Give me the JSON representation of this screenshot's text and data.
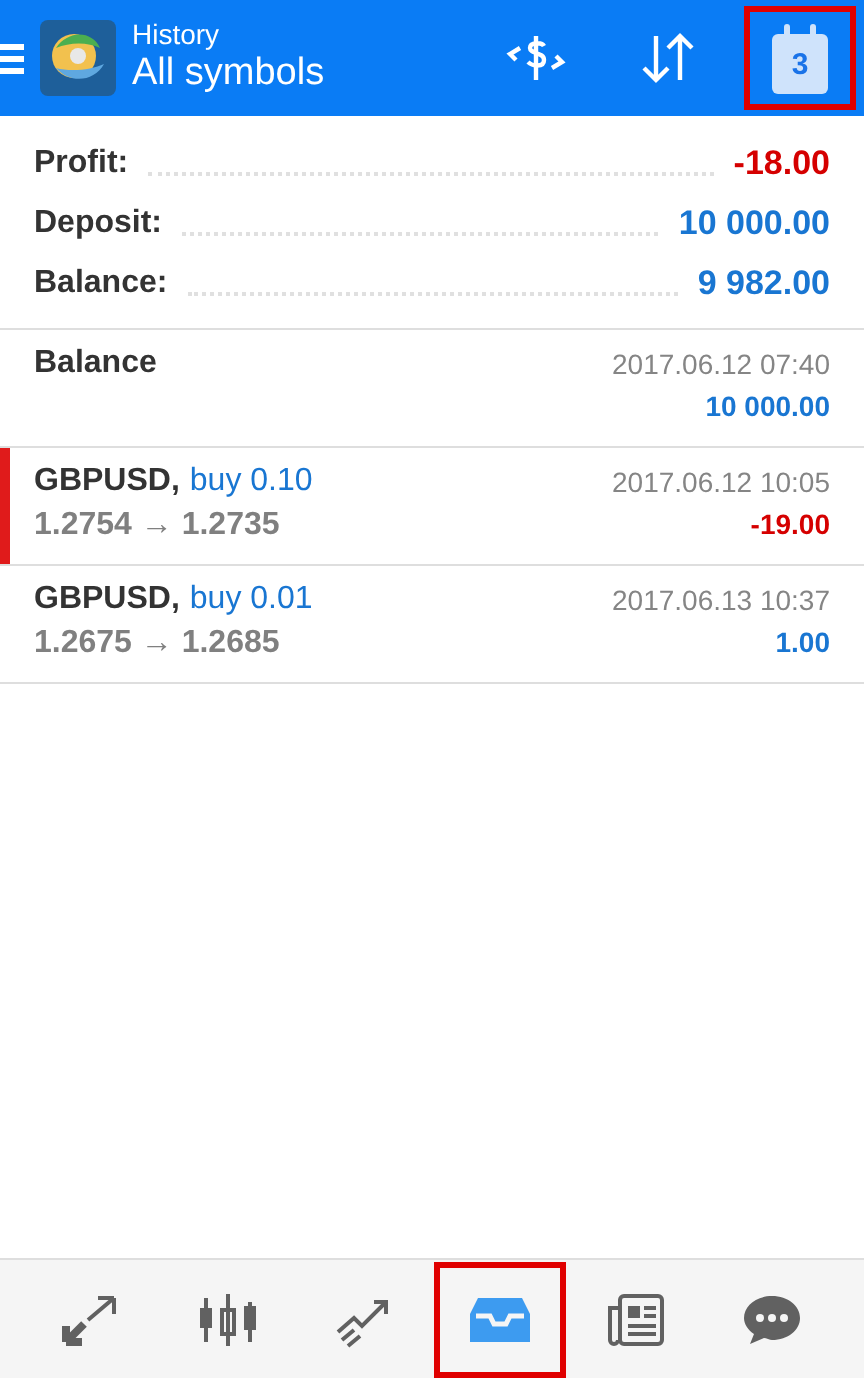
{
  "header": {
    "title": "History",
    "subtitle": "All symbols",
    "actions": [
      {
        "kind": "currency",
        "highlighted": false
      },
      {
        "kind": "sort",
        "highlighted": false
      },
      {
        "kind": "calendar",
        "label": "3",
        "highlighted": true
      }
    ]
  },
  "summary": [
    {
      "label": "Profit:",
      "value": "-18.00",
      "color": "#d50000"
    },
    {
      "label": "Deposit:",
      "value": "10 000.00",
      "color": "#1976d2"
    },
    {
      "label": "Balance:",
      "value": "9 982.00",
      "color": "#1976d2"
    }
  ],
  "entries": [
    {
      "kind": "balance",
      "title": "Balance",
      "time": "2017.06.12 07:40",
      "amount": "10 000.00",
      "color": "#1976d2",
      "selected": false
    },
    {
      "kind": "trade",
      "symbol": "GBPUSD,",
      "side": "buy 0.10",
      "prices": "1.2754 → 1.2735",
      "time": "2017.06.12 10:05",
      "amount": "-19.00",
      "color": "#d50000",
      "selected": true
    },
    {
      "kind": "trade",
      "symbol": "GBPUSD,",
      "side": "buy 0.01",
      "prices": "1.2675 → 1.2685",
      "time": "2017.06.13 10:37",
      "amount": "1.00",
      "color": "#1976d2",
      "selected": false
    }
  ],
  "bottom_nav": [
    {
      "kind": "quotes",
      "selected": false,
      "highlighted": false
    },
    {
      "kind": "chart",
      "selected": false,
      "highlighted": false
    },
    {
      "kind": "trade",
      "selected": false,
      "highlighted": false
    },
    {
      "kind": "history",
      "selected": true,
      "highlighted": true
    },
    {
      "kind": "news",
      "selected": false,
      "highlighted": false
    },
    {
      "kind": "chat",
      "selected": false,
      "highlighted": false
    }
  ]
}
